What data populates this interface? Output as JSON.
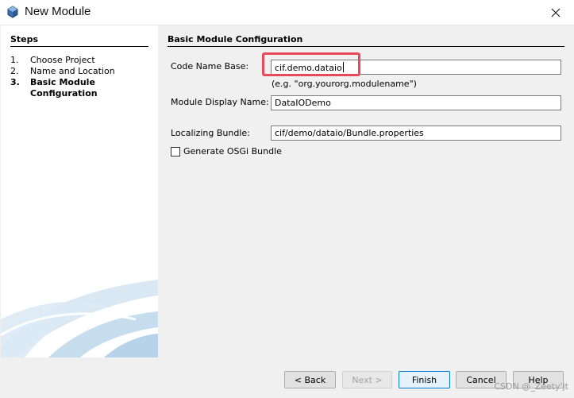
{
  "window": {
    "title": "New Module",
    "icon": "netbeans-module-icon"
  },
  "steps": {
    "heading": "Steps",
    "items": [
      {
        "num": "1.",
        "label": "Choose Project"
      },
      {
        "num": "2.",
        "label": "Name and Location"
      },
      {
        "num": "3.",
        "label": "Basic Module Configuration"
      }
    ],
    "current_index": 3
  },
  "form": {
    "heading": "Basic Module Configuration",
    "code_name_base": {
      "label": "Code Name Base:",
      "value": "cif.demo.dataio",
      "hint": "(e.g. \"org.yourorg.modulename\")"
    },
    "module_display_name": {
      "label": "Module Display Name:",
      "value": "DataIODemo"
    },
    "localizing_bundle": {
      "label": "Localizing Bundle:",
      "value": "cif/demo/dataio/Bundle.properties"
    },
    "generate_osgi": {
      "label": "Generate OSGi Bundle",
      "checked": false
    }
  },
  "buttons": {
    "back": "< Back",
    "next": "Next >",
    "finish": "Finish",
    "cancel": "Cancel",
    "help": "Help"
  },
  "watermark": "CSDN @_Zeety'jt",
  "colors": {
    "highlight": "#e94a5b",
    "accent": "#0078d7"
  }
}
